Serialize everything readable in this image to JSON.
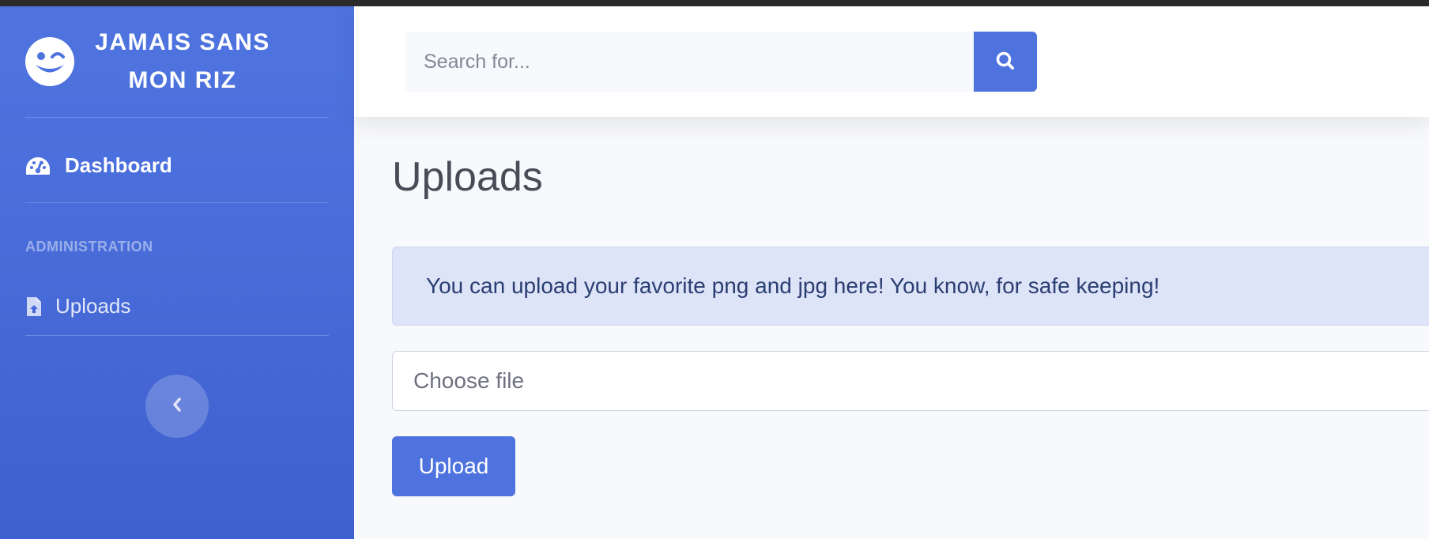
{
  "sidebar": {
    "brand": {
      "line1": "JAMAIS SANS",
      "line2": "MON RIZ",
      "icon": "grin-wink-icon"
    },
    "nav": {
      "dashboard": {
        "label": "Dashboard",
        "icon": "tachometer-icon"
      },
      "section_heading": "ADMINISTRATION",
      "uploads": {
        "label": "Uploads",
        "icon": "file-upload-icon"
      }
    },
    "toggle_icon": "chevron-left-icon"
  },
  "topbar": {
    "search": {
      "placeholder": "Search for...",
      "value": "",
      "button_icon": "search-icon"
    }
  },
  "content": {
    "page_title": "Uploads",
    "alert_text": "You can upload your favorite png and jpg here! You know, for safe keeping!",
    "file_input_label": "Choose file",
    "upload_button": "Upload"
  },
  "colors": {
    "primary": "#4e73df",
    "alert_bg": "#dde4f8",
    "page_bg": "#f8f9fc"
  }
}
